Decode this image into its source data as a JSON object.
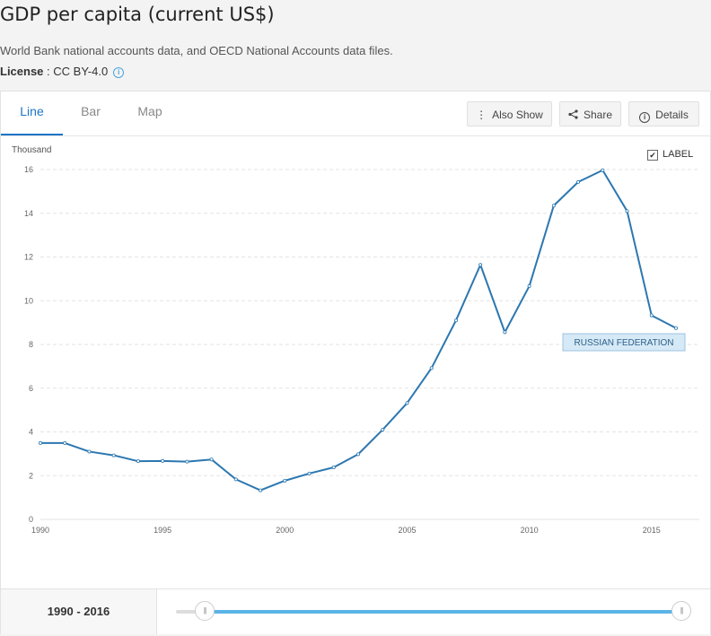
{
  "header": {
    "title": "GDP per capita (current US$)",
    "source": "World Bank national accounts data, and OECD National Accounts data files.",
    "license_label": "License",
    "license_value": " : CC BY-4.0"
  },
  "tabs": [
    {
      "label": "Line",
      "active": true
    },
    {
      "label": "Bar",
      "active": false
    },
    {
      "label": "Map",
      "active": false
    }
  ],
  "toolbar": {
    "also_show": "Also Show",
    "share": "Share",
    "details": "Details"
  },
  "label_toggle": {
    "label": "LABEL",
    "checked": true
  },
  "range": {
    "label": "1990 - 2016",
    "start": 1990,
    "end": 2016
  },
  "colors": {
    "line": "#2c77b0",
    "accent": "#1d74c5",
    "slider": "#5ab4e6"
  },
  "chart_data": {
    "type": "line",
    "title": "",
    "unit_label": "Thousand",
    "xlabel": "",
    "ylabel": "",
    "xlim": [
      1990,
      2016
    ],
    "ylim": [
      0,
      16
    ],
    "x_ticks": [
      1990,
      1995,
      2000,
      2005,
      2010,
      2015
    ],
    "y_ticks": [
      0,
      2,
      4,
      6,
      8,
      10,
      12,
      14,
      16
    ],
    "grid": true,
    "series": [
      {
        "name": "RUSSIAN FEDERATION",
        "x": [
          1990,
          1991,
          1992,
          1993,
          1994,
          1995,
          1996,
          1997,
          1998,
          1999,
          2000,
          2001,
          2002,
          2003,
          2004,
          2005,
          2006,
          2007,
          2008,
          2009,
          2010,
          2011,
          2012,
          2013,
          2014,
          2015,
          2016
        ],
        "y": [
          3.49,
          3.49,
          3.1,
          2.93,
          2.66,
          2.67,
          2.64,
          2.74,
          1.83,
          1.33,
          1.77,
          2.1,
          2.38,
          2.98,
          4.1,
          5.32,
          6.92,
          9.1,
          11.64,
          8.56,
          10.67,
          14.35,
          15.43,
          15.97,
          14.1,
          9.33,
          8.75
        ]
      }
    ]
  }
}
